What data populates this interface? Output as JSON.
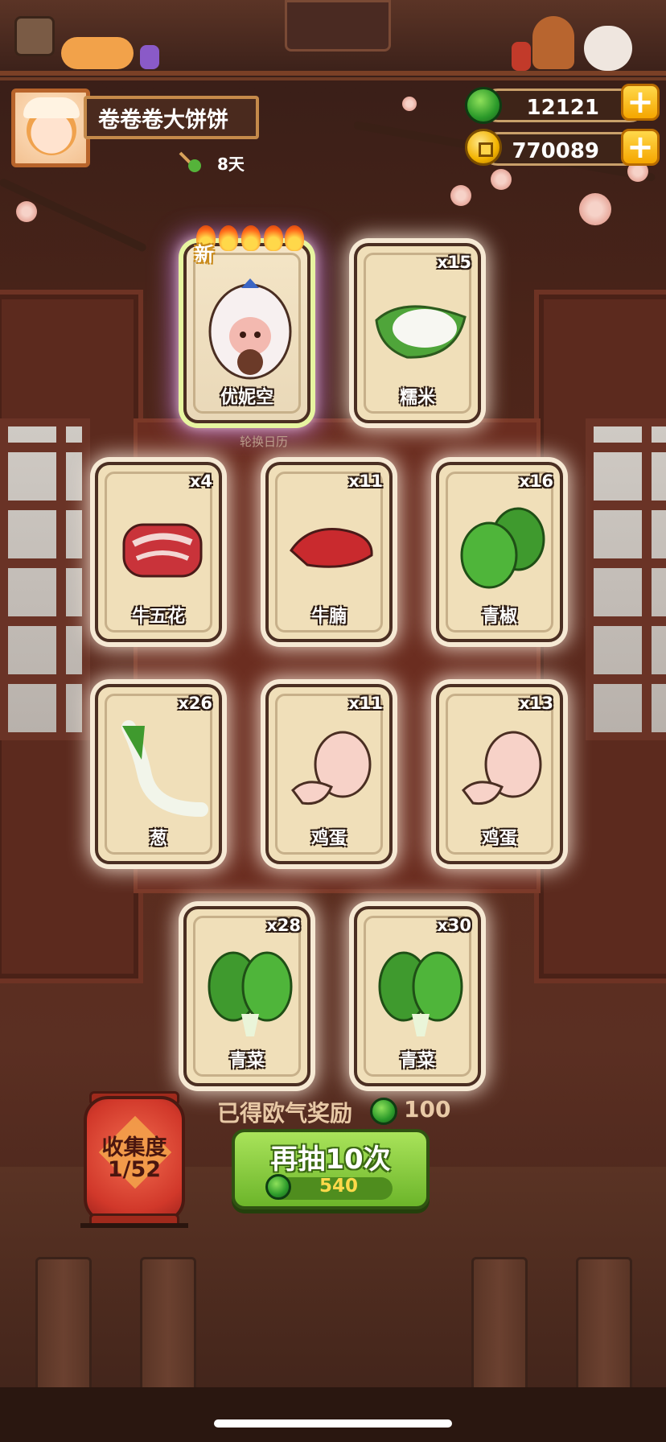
{
  "player": {
    "name": "卷卷卷大饼饼",
    "days": "8天"
  },
  "currency": {
    "gems": "12121",
    "coins": "770089"
  },
  "icons": {
    "gem": "green-jade-gem-icon",
    "coin": "gold-coin-icon",
    "plus": "plus-icon",
    "flame": "flame-icon"
  },
  "calendar_label": "轮换日历",
  "cards": [
    {
      "name": "优妮空",
      "count": "",
      "new": "新",
      "flames": 5
    },
    {
      "name": "糯米",
      "count": "x15"
    },
    {
      "name": "牛五花",
      "count": "x4"
    },
    {
      "name": "牛腩",
      "count": "x11"
    },
    {
      "name": "青椒",
      "count": "x16"
    },
    {
      "name": "葱",
      "count": "x26"
    },
    {
      "name": "鸡蛋",
      "count": "x11"
    },
    {
      "name": "鸡蛋",
      "count": "x13"
    },
    {
      "name": "青菜",
      "count": "x28"
    },
    {
      "name": "青菜",
      "count": "x30"
    }
  ],
  "bonus": {
    "label": "已得欧气奖励",
    "value": "100"
  },
  "draw_button": {
    "label": "再抽10次",
    "cost": "540"
  },
  "collection": {
    "title": "收集度",
    "progress": "1/52"
  },
  "colors": {
    "button_green": "#6cb52a",
    "plus_gold": "#f5a600",
    "lantern_red": "#d1382a"
  }
}
